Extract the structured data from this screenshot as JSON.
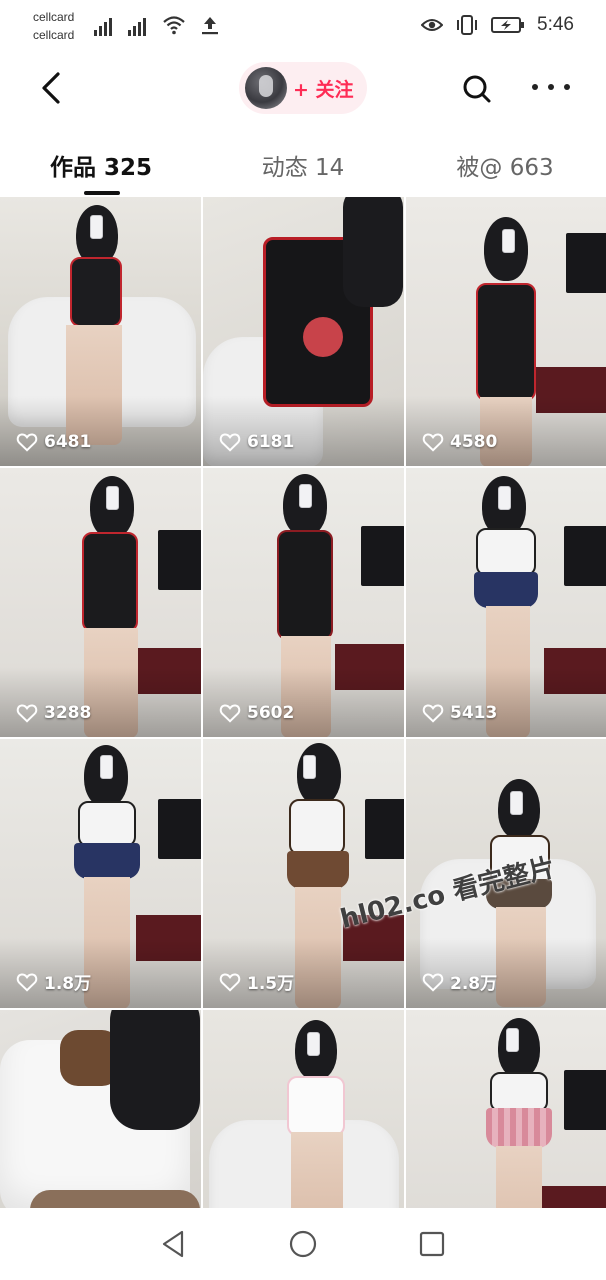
{
  "status_bar": {
    "carrier_1": "cellcard",
    "carrier_2": "cellcard",
    "time": "5:46",
    "icons": [
      "signal-icon",
      "signal-icon",
      "wifi-icon",
      "upload-icon",
      "eye-icon",
      "vibrate-icon",
      "battery-charging-icon"
    ]
  },
  "header": {
    "back_icon": "back-arrow-icon",
    "follow_label": "+ 关注",
    "search_icon": "search-icon",
    "more_icon": "more-icon"
  },
  "tabs": [
    {
      "label": "作品 325",
      "active": true
    },
    {
      "label": "动态 14",
      "active": false
    },
    {
      "label": "被@ 663",
      "active": false
    }
  ],
  "grid": {
    "accent_color": "#fe2c55",
    "items": [
      {
        "likes": "6481"
      },
      {
        "likes": "6181"
      },
      {
        "likes": "4580"
      },
      {
        "likes": "3288"
      },
      {
        "likes": "5602"
      },
      {
        "likes": "5413"
      },
      {
        "likes": "1.8万"
      },
      {
        "likes": "1.5万"
      },
      {
        "likes": "2.8万"
      },
      {
        "likes": ""
      },
      {
        "likes": ""
      },
      {
        "likes": ""
      }
    ]
  },
  "watermark": "hl02.co 看完整片",
  "nav_bar": {
    "icons": [
      "nav-back-icon",
      "nav-home-icon",
      "nav-recents-icon"
    ]
  }
}
